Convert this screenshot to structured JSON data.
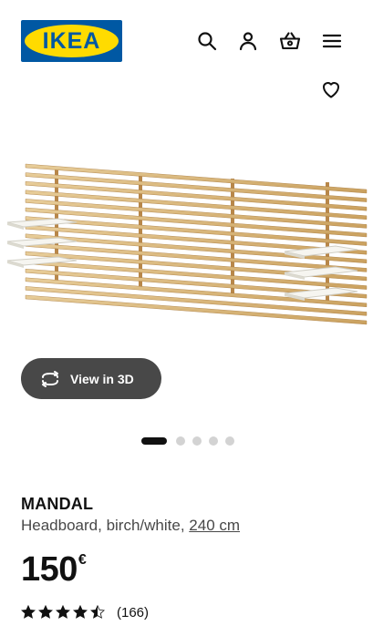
{
  "header": {
    "logo_text": "IKEA",
    "icons": [
      "search-icon",
      "account-icon",
      "basket-icon",
      "menu-icon"
    ]
  },
  "product": {
    "image_icon": "headboard-product-image",
    "favourite_icon": "heart-icon",
    "view_3d_label": "View in 3D",
    "carousel": {
      "total": 5,
      "active": 1
    },
    "name": "MANDAL",
    "description": "Headboard, birch/white, ",
    "size_link": "240 cm",
    "price_integer": "150",
    "price_currency": "€",
    "rating_value": 4.5,
    "rating_count": "(166)"
  },
  "colors": {
    "brand_blue": "#0058a3",
    "brand_yellow": "#ffdb00",
    "button_bg": "#484848",
    "text": "#111111"
  }
}
